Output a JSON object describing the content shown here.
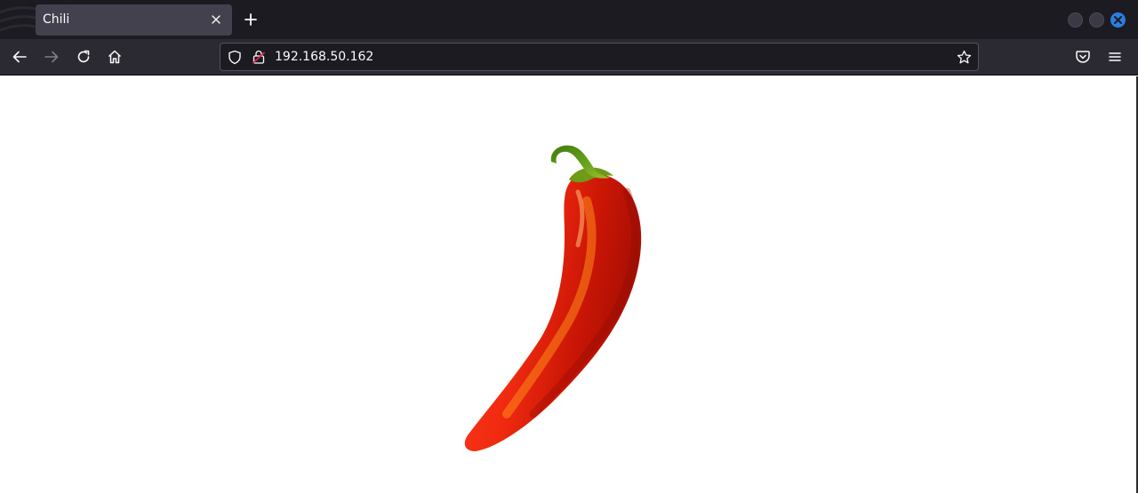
{
  "browser": {
    "tab": {
      "title": "Chili",
      "close_icon": "close-icon"
    },
    "new_tab_icon": "plus-icon",
    "window_controls": [
      "minimize",
      "maximize",
      "close"
    ],
    "close_color": "#2b7de0"
  },
  "toolbar": {
    "back_icon": "arrow-left-icon",
    "forward_icon": "arrow-right-icon",
    "reload_icon": "reload-icon",
    "home_icon": "home-icon",
    "url": "192.168.50.162",
    "tracking_icon": "shield-icon",
    "insecure_icon": "insecure-lock-icon",
    "bookmark_icon": "star-icon",
    "pocket_icon": "pocket-icon",
    "menu_icon": "hamburger-menu-icon"
  },
  "page": {
    "image": "chili-pepper-watercolor",
    "colors": {
      "chili_red": "#e8250f",
      "stem_green": "#4f8a12"
    }
  }
}
